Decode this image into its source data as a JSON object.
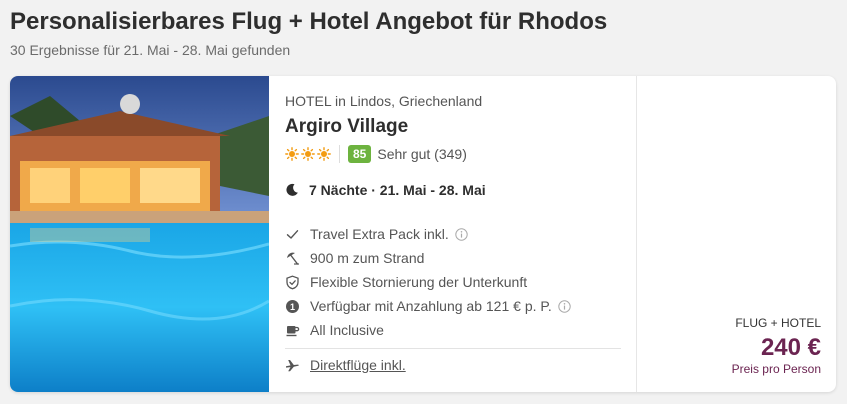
{
  "header": {
    "title": "Personalisierbares Flug + Hotel Angebot für Rhodos",
    "subtitle": "30 Ergebnisse für 21. Mai - 28. Mai gefunden"
  },
  "offer": {
    "location": "HOTEL in Lindos, Griechenland",
    "name": "Argiro Village",
    "stars": 3,
    "score": "85",
    "rating_text": "Sehr gut (349)",
    "duration": "7 Nächte · 21. Mai - 28. Mai",
    "features": [
      {
        "icon": "check-icon",
        "text": "Travel Extra Pack inkl.",
        "info": true
      },
      {
        "icon": "beach-umbrella-icon",
        "text": "900 m zum Strand",
        "info": false
      },
      {
        "icon": "shield-check-icon",
        "text": "Flexible Stornierung der Unterkunft",
        "info": false
      },
      {
        "icon": "deposit-icon",
        "text": "Verfügbar mit Anzahlung ab 121 € p. P.",
        "info": true
      },
      {
        "icon": "coffee-cup-icon",
        "text": "All Inclusive",
        "info": false
      }
    ],
    "flight_text": "Direktflüge inkl.",
    "price_type": "FLUG + HOTEL",
    "price": "240 €",
    "price_note": "Preis pro Person"
  },
  "colors": {
    "price": "#6b2451",
    "score_badge": "#6db33f",
    "star": "#f39c12"
  }
}
